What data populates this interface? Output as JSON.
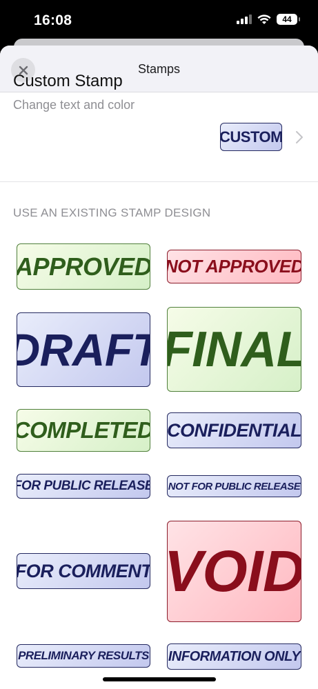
{
  "status_bar": {
    "time": "16:08",
    "battery": "44",
    "icons": [
      "signal-icon",
      "wifi-icon",
      "battery-icon"
    ]
  },
  "nav": {
    "title": "Stamps",
    "close_icon": "close-icon"
  },
  "custom": {
    "title": "Custom Stamp",
    "subtitle": "Change text and color",
    "stamp_label": "CUSTOM",
    "chevron_icon": "chevron-right-icon"
  },
  "section_header": "USE AN EXISTING STAMP DESIGN",
  "stamps": [
    {
      "label": "APPROVED",
      "color": "green"
    },
    {
      "label": "NOT APPROVED",
      "color": "red"
    },
    {
      "label": "DRAFT",
      "color": "blue"
    },
    {
      "label": "FINAL",
      "color": "green"
    },
    {
      "label": "COMPLETED",
      "color": "green"
    },
    {
      "label": "CONFIDENTIAL",
      "color": "blue"
    },
    {
      "label": "FOR PUBLIC RELEASE",
      "color": "blue"
    },
    {
      "label": "NOT FOR PUBLIC RELEASE",
      "color": "blue"
    },
    {
      "label": "FOR COMMENT",
      "color": "blue"
    },
    {
      "label": "VOID",
      "color": "red"
    },
    {
      "label": "PRELIMINARY RESULTS",
      "color": "blue"
    },
    {
      "label": "INFORMATION ONLY",
      "color": "blue"
    }
  ],
  "colors": {
    "green": "#2f5e1c",
    "blue": "#1a1f5c",
    "red": "#8a0e1c"
  }
}
